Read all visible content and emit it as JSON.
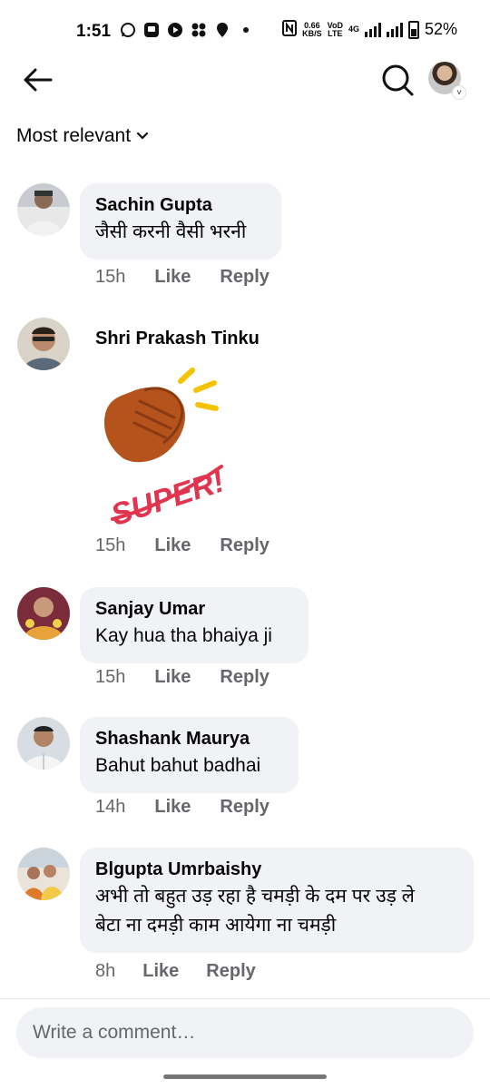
{
  "status_bar": {
    "time": "1:51",
    "net_speed_value": "0.66",
    "net_speed_unit": "KB/S",
    "volte_top": "VoD",
    "volte_bottom": "LTE",
    "network": "4G",
    "battery": "52%"
  },
  "header": {
    "back_icon": "arrow-left-icon",
    "search_icon": "search-icon",
    "profile_icon": "profile-avatar"
  },
  "sort": {
    "label": "Most relevant",
    "chevron": "˅"
  },
  "comments": [
    {
      "author": "Sachin Gupta",
      "text": "जैसी करनी वैसी भरनी",
      "time": "15h",
      "like": "Like",
      "reply": "Reply"
    },
    {
      "author": "Shri Prakash Tinku",
      "sticker_text": "SUPER!",
      "time": "15h",
      "like": "Like",
      "reply": "Reply"
    },
    {
      "author": "Sanjay Umar",
      "text": "Kay hua tha bhaiya ji",
      "time": "15h",
      "like": "Like",
      "reply": "Reply"
    },
    {
      "author": "Shashank Maurya",
      "text": "Bahut bahut badhai",
      "time": "14h",
      "like": "Like",
      "reply": "Reply"
    },
    {
      "author": "Blgupta Umrbaishy",
      "text_line1": "अभी तो बहुत उड़ रहा है चमड़ी के दम पर उड़ ले",
      "text_line2": "बेटा ना दमड़ी काम आयेगा ना चमड़ी",
      "time": "8h",
      "like": "Like",
      "reply": "Reply"
    }
  ],
  "composer": {
    "placeholder": "Write a comment…"
  },
  "colors": {
    "bubble": "#f0f2f5",
    "secondary_text": "#65676b",
    "sticker_hand": "#b5531c",
    "sticker_text": "#e0344f",
    "sticker_rays": "#f5c400"
  }
}
